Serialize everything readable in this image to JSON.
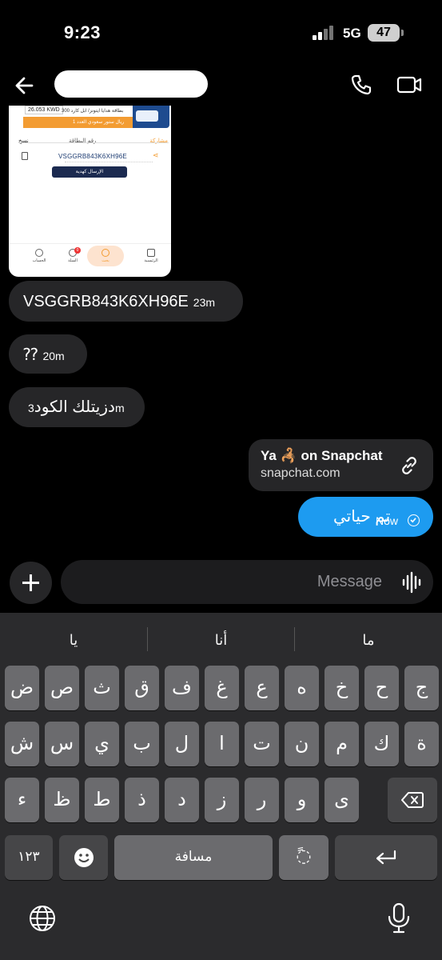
{
  "status_bar": {
    "time": "9:23",
    "network": "5G",
    "battery": "47"
  },
  "header": {
    "contact_name": ""
  },
  "shared_screenshot": {
    "price": "26.053 KWD",
    "title": "بطاقة هدايا ايتونز/ ابل كارد 300",
    "subtitle": "ريال ستور سعودي  العدد 1",
    "share_label": "مشاركة",
    "card_number_label": "رقم البطاقة",
    "copy_label": "نسخ",
    "card_code": "VSGGRB843K6XH96E",
    "gift_button": "الإرسال كهدية",
    "nav": [
      "الرئيسية",
      "بحث",
      "السلة",
      "الحساب"
    ]
  },
  "messages": [
    {
      "text": "VSGGRB843K6XH96E",
      "time": "23m"
    },
    {
      "text": "⁇",
      "time": "20m"
    },
    {
      "text": "دزيتلك الكود",
      "time": "3m"
    }
  ],
  "link_card": {
    "title_before": "Ya",
    "title_emoji": "🦂",
    "title_after": "on Snapchat",
    "url": "snapchat.com"
  },
  "sent_message": {
    "text": "تم حياتي",
    "time": "Now"
  },
  "composer": {
    "placeholder": "Message"
  },
  "keyboard": {
    "suggestions": [
      "يا",
      "أنا",
      "ما"
    ],
    "row1": [
      "ض",
      "ص",
      "ث",
      "ق",
      "ف",
      "غ",
      "ع",
      "ه",
      "خ",
      "ح",
      "ج"
    ],
    "row2": [
      "ش",
      "س",
      "ي",
      "ب",
      "ل",
      "ا",
      "ت",
      "ن",
      "م",
      "ك",
      "ة"
    ],
    "row3": [
      "ء",
      "ظ",
      "ط",
      "ذ",
      "د",
      "ز",
      "ر",
      "و",
      "ى"
    ],
    "numbers_key": "١٢٣",
    "space_key": "مسافة",
    "diacritic_key": "◌ً"
  }
}
